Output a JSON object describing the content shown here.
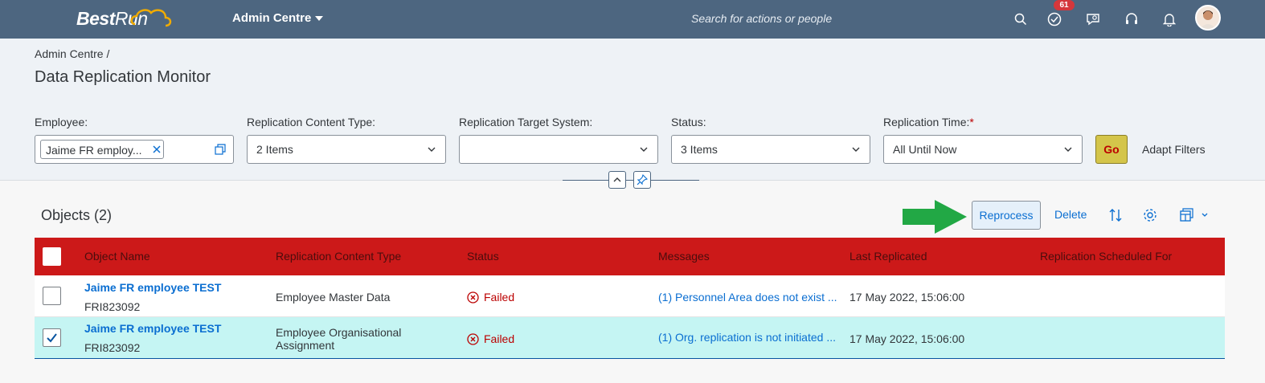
{
  "shell": {
    "logo_bold": "Best",
    "logo_rest": "Run",
    "app_title": "Admin Centre",
    "search_placeholder": "Search for actions or people",
    "notification_count": "61",
    "icons": [
      "search-icon",
      "todo-check-icon",
      "feedback-icon",
      "support-headset-icon",
      "notification-bell-icon",
      "user-avatar"
    ]
  },
  "header": {
    "breadcrumb": "Admin Centre /",
    "title": "Data Replication Monitor"
  },
  "filters": {
    "employee": {
      "label": "Employee:",
      "token": "Jaime FR employ..."
    },
    "content_type": {
      "label": "Replication Content Type:",
      "value": "2 Items"
    },
    "target_system": {
      "label": "Replication Target System:",
      "value": ""
    },
    "status": {
      "label": "Status:",
      "value": "3 Items"
    },
    "time": {
      "label": "Replication Time:",
      "required_mark": "*",
      "value": "All Until Now"
    },
    "go_label": "Go",
    "adapt_label": "Adapt Filters"
  },
  "toolbar": {
    "objects_title": "Objects (2)",
    "reprocess_label": "Reprocess",
    "delete_label": "Delete"
  },
  "table": {
    "columns": [
      "Object Name",
      "Replication Content Type",
      "Status",
      "Messages",
      "Last Replicated",
      "Replication Scheduled For"
    ],
    "rows": [
      {
        "name": "Jaime FR employee TEST",
        "id": "FRI823092",
        "content_type_line1": "Employee Master Data",
        "content_type_line2": "",
        "status": "Failed",
        "message": "(1) Personnel Area does not exist ...",
        "last_replicated": "17 May 2022, 15:06:00",
        "scheduled_for": "",
        "selected": false
      },
      {
        "name": "Jaime FR employee TEST",
        "id": "FRI823092",
        "content_type_line1": "Employee Organisational",
        "content_type_line2": "Assignment",
        "status": "Failed",
        "message": "(1) Org. replication is not initiated ...",
        "last_replicated": "17 May 2022, 15:06:00",
        "scheduled_for": "",
        "selected": true
      }
    ]
  },
  "colors": {
    "shell": "#4d6680",
    "header_row": "#cc1919",
    "selected_row": "#c5f5f3",
    "link": "#0a6ed1",
    "error": "#bb0000",
    "go_button": "#d4c54a",
    "arrow": "#22a845"
  }
}
